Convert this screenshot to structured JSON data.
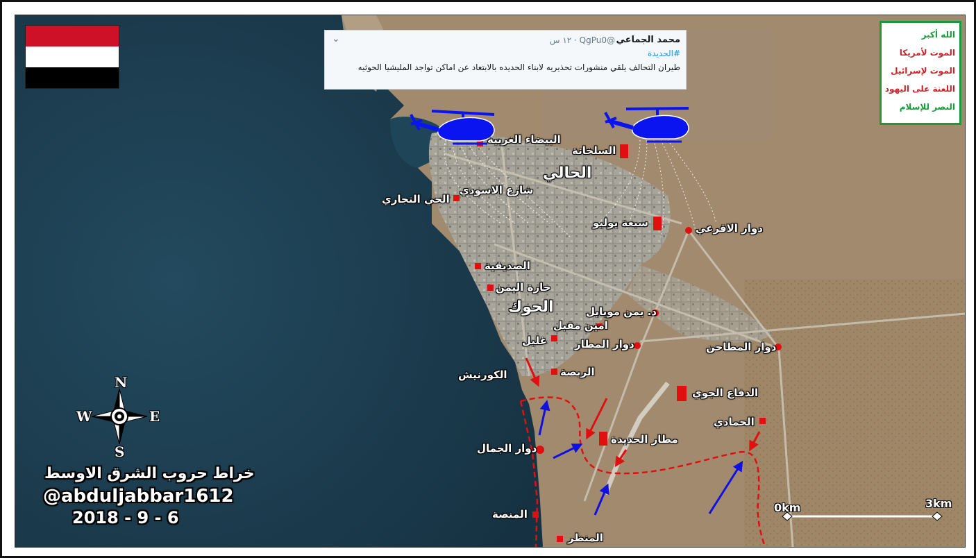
{
  "tweet": {
    "author": "محمد الجماعي",
    "handle": "@QgPu0 · ١٢ س",
    "hashtag": "#الحديدة",
    "text": "طيران التحالف يلقي منشورات تحذيريه لابناء الحديده بالابتعاد عن اماكن تواجد المليشيا الحوثيه",
    "menu_icon": "chevron-down-icon"
  },
  "slogan": {
    "lines": [
      "الله أكبر",
      "الموت لأمريكا",
      "الموت لإسرائيل",
      "اللعنة على اليهود",
      "النصر للإسلام"
    ],
    "colors": [
      "#1a9b3a",
      "#d0202a",
      "#d0202a",
      "#d0202a",
      "#1a9b3a"
    ],
    "border_color": "#1a9b3a"
  },
  "flag": {
    "colors": [
      "#ce1126",
      "#ffffff",
      "#000000"
    ]
  },
  "districts": {
    "hali": "الحالي",
    "hawk": "الحوك"
  },
  "places": {
    "baida": "البيضاء الغربية",
    "salkhana": "السلخانة",
    "aswadi": "شارع الاسودي",
    "tijari": "الحي التجاري",
    "sabaa": "سبعة يوليو",
    "aqraei": "دوار الاقرعي",
    "sadiqiya": "الصديقية",
    "yemen_quarter": "حارة اليمن",
    "yemen_mobile": "د. يمن موبايل",
    "amin": "امين مقبل",
    "ghulail": "غليل",
    "airport_rb": "دوار المطار",
    "matahin": "دوار المطاحن",
    "rabsa": "الربصة",
    "corniche": "الكورنيش",
    "air_defense": "الدفاع الجوي",
    "hamadi": "الحمادي",
    "airport": "مطار الحديدة",
    "jamal": "دوار الجمال",
    "minassa": "المنصة",
    "manzar": "المنظر"
  },
  "compass": {
    "n": "N",
    "s": "S",
    "e": "E",
    "w": "W"
  },
  "scale": {
    "start": "0km",
    "end": "3km"
  },
  "credit": {
    "line1": "خراط حروب الشرق الاوسط",
    "handle": "@abduljabbar1612",
    "date": "2018 - 9 - 6"
  },
  "colors": {
    "sea": "#1e3f52",
    "land": "#a28a6e",
    "city": "#9a9890",
    "marker": "#e01010",
    "front_line": "#e01010",
    "coalition_arrow": "#1010e0",
    "houthi_arrow": "#e01010",
    "helicopter": "#0a14f0"
  },
  "icons": [
    "helicopter-icon",
    "compass-rose-icon",
    "map-marker-square",
    "map-marker-circle"
  ]
}
